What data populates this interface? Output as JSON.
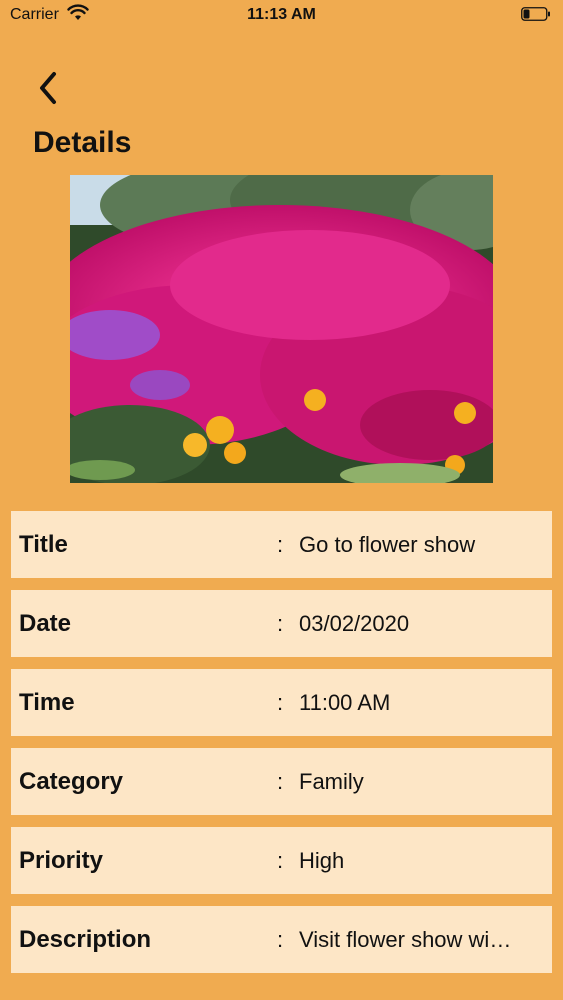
{
  "status_bar": {
    "carrier": "Carrier",
    "time": "11:13 AM"
  },
  "nav": {
    "back_icon": "chevron-left-icon",
    "title": "Details"
  },
  "photo": {
    "subject": "flower-field-photo"
  },
  "details": [
    {
      "label": "Title",
      "separator": ":",
      "value": "Go to flower show"
    },
    {
      "label": "Date",
      "separator": ":",
      "value": "03/02/2020"
    },
    {
      "label": "Time",
      "separator": ":",
      "value": "11:00 AM"
    },
    {
      "label": "Category",
      "separator": ":",
      "value": "Family"
    },
    {
      "label": "Priority",
      "separator": ":",
      "value": "High"
    },
    {
      "label": "Description",
      "separator": ":",
      "value": "Visit flower show wi…"
    }
  ],
  "colors": {
    "background": "#f0ab50",
    "row_background": "#fde6c6"
  }
}
